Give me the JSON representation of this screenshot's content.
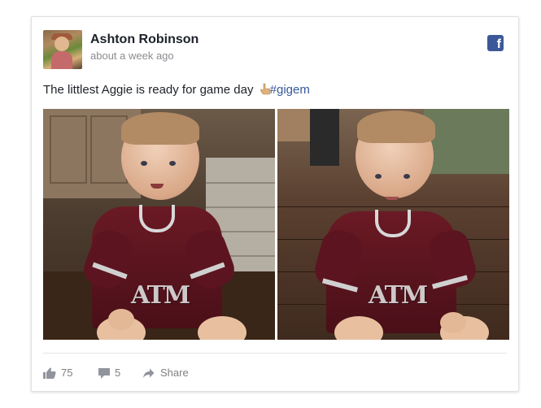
{
  "post": {
    "author": "Ashton Robinson",
    "timestamp": "about a week ago",
    "text": "The littlest Aggie is ready for game day ",
    "emoji": "finger-pointing-up-emoji",
    "hashtag": "#gigem",
    "platform_icon": "facebook-icon"
  },
  "photos": [
    {
      "description_icon": "photo",
      "name": "photo-left"
    },
    {
      "description_icon": "photo",
      "name": "photo-right"
    }
  ],
  "jersey": {
    "logo_text": "ATM"
  },
  "actions": {
    "likes": "75",
    "comments": "5",
    "share_label": "Share"
  },
  "colors": {
    "facebook_blue": "#3b5998",
    "hashtag": "#365899",
    "author": "#1d2129",
    "muted": "#8a8d91",
    "action_gray": "#7f7f7f",
    "maroon": "#500000"
  }
}
